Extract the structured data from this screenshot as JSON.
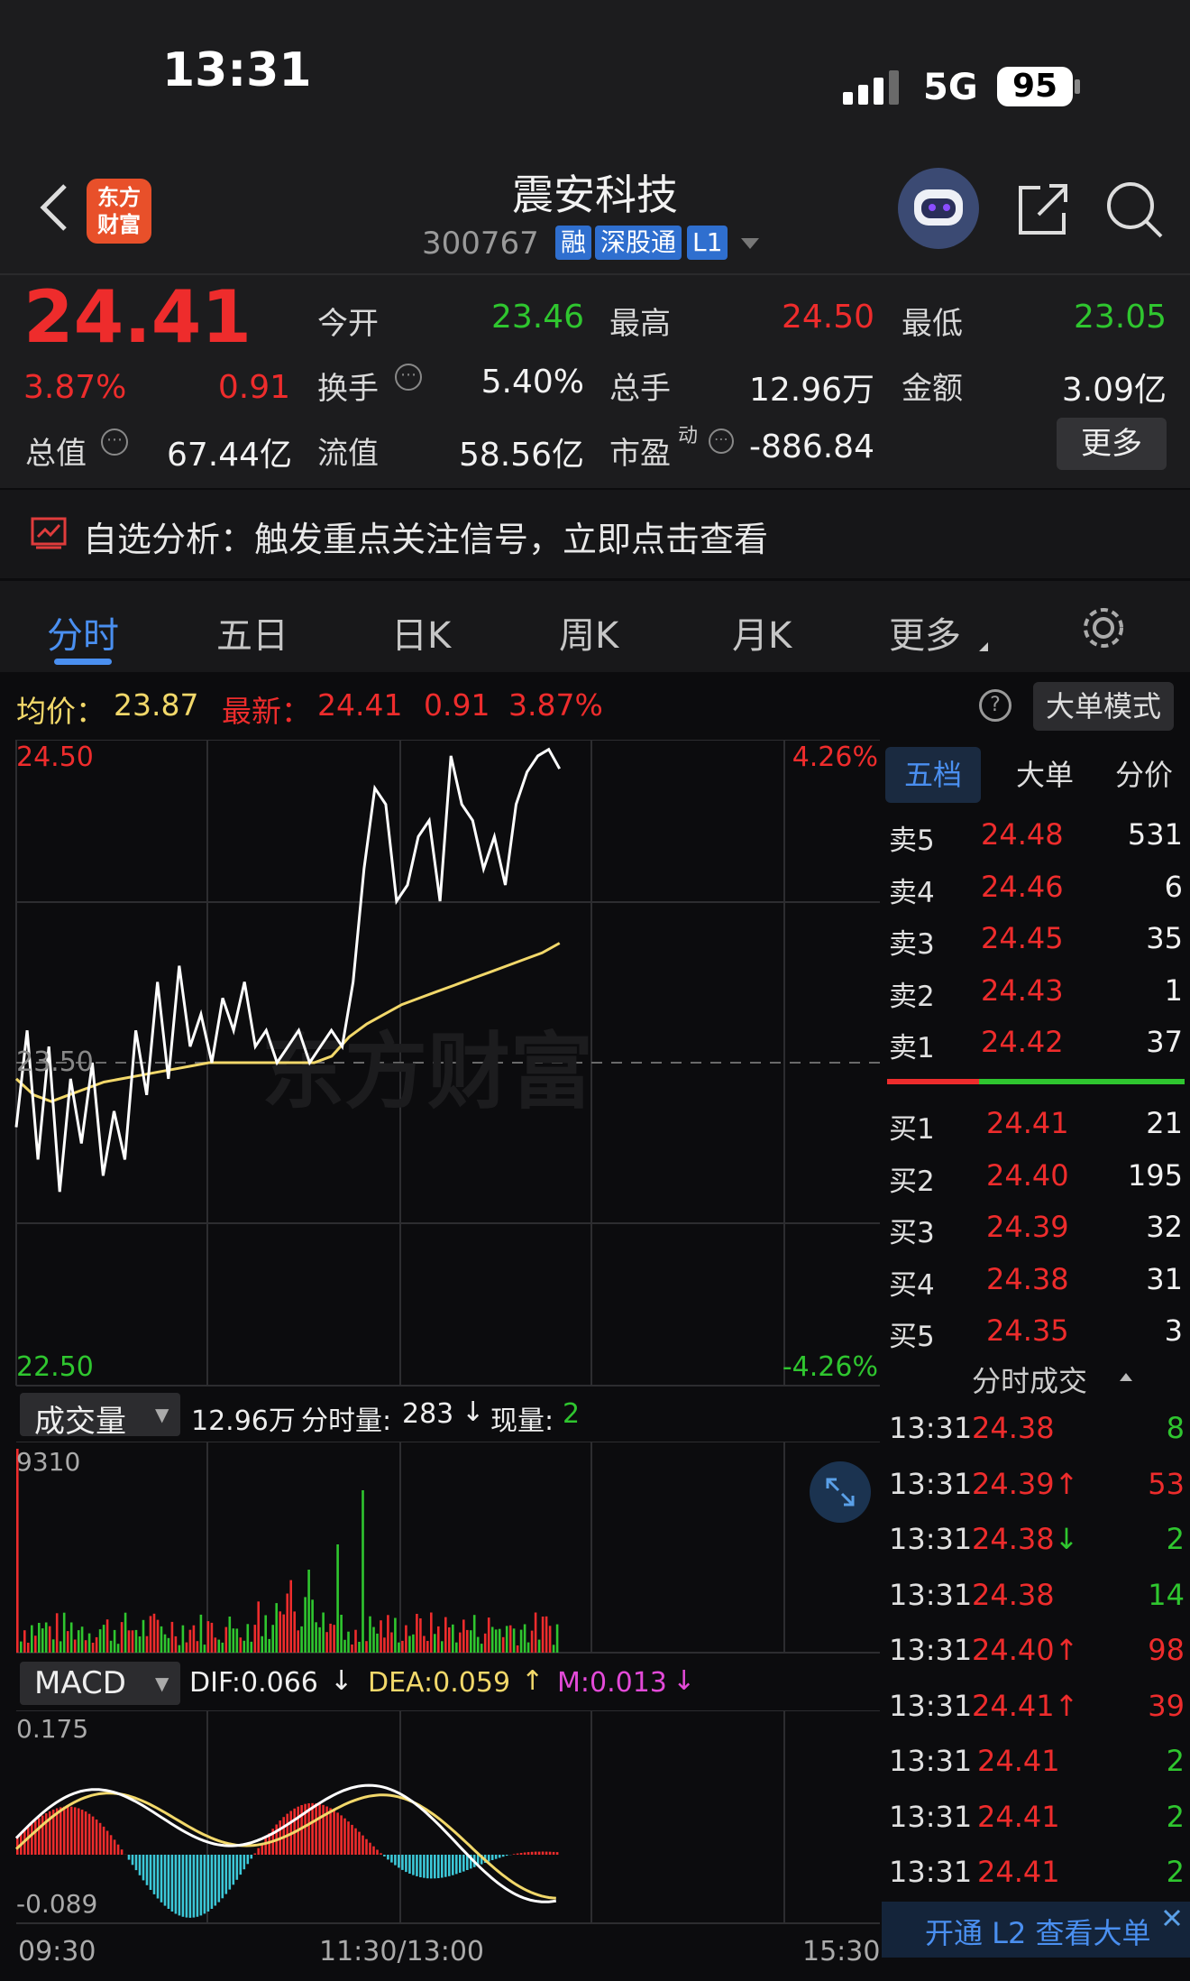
{
  "status_bar": {
    "time": "13:31",
    "network": "5G",
    "battery": "95"
  },
  "header": {
    "brand_line1": "东方",
    "brand_line2": "财富",
    "stock_name": "震安科技",
    "stock_code": "300767",
    "tags": [
      "融",
      "深股通",
      "L1"
    ]
  },
  "quote": {
    "price": "24.41",
    "change_pct": "3.87%",
    "change": "0.91",
    "fields": {
      "open_label": "今开",
      "open": "23.46",
      "high_label": "最高",
      "high": "24.50",
      "low_label": "最低",
      "low": "23.05",
      "turnover_label": "换手",
      "turnover": "5.40%",
      "volume_label": "总手",
      "volume": "12.96万",
      "amount_label": "金额",
      "amount": "3.09亿",
      "mcap_label": "总值",
      "mcap": "67.44亿",
      "float_label": "流值",
      "float": "58.56亿",
      "pe_label": "市盈",
      "pe_sup": "动",
      "pe": "-886.84"
    },
    "more_button": "更多"
  },
  "analysis_banner": "自选分析：触发重点关注信号，立即点击查看",
  "chart_tabs": [
    "分时",
    "五日",
    "日K",
    "周K",
    "月K",
    "更多"
  ],
  "active_tab": "分时",
  "summary": {
    "avg_label": "均价：",
    "avg": "23.87",
    "last_label": "最新：",
    "last": "24.41",
    "chg": "0.91",
    "pct": "3.87%",
    "mode_button": "大单模式",
    "help_icon": "?"
  },
  "chart_data": {
    "type": "line",
    "y_top": "24.50",
    "y_mid": "23.50",
    "y_bottom": "22.50",
    "pct_top": "4.26%",
    "pct_bottom": "-4.26%",
    "watermark": "东方财富",
    "x_labels": [
      "09:30",
      "11:30/13:00",
      "15:30"
    ],
    "ylim": [
      22.5,
      24.5
    ],
    "price_series": [
      23.3,
      23.6,
      23.2,
      23.55,
      23.1,
      23.45,
      23.25,
      23.5,
      23.15,
      23.35,
      23.2,
      23.6,
      23.4,
      23.75,
      23.45,
      23.8,
      23.55,
      23.65,
      23.5,
      23.7,
      23.6,
      23.75,
      23.55,
      23.6,
      23.5,
      23.55,
      23.6,
      23.5,
      23.55,
      23.6,
      23.55,
      23.75,
      24.1,
      24.35,
      24.3,
      24.0,
      24.05,
      24.2,
      24.25,
      24.0,
      24.45,
      24.3,
      24.25,
      24.1,
      24.2,
      24.05,
      24.3,
      24.4,
      24.45,
      24.47,
      24.41
    ],
    "avg_series": [
      23.45,
      23.4,
      23.38,
      23.4,
      23.42,
      23.44,
      23.45,
      23.46,
      23.47,
      23.48,
      23.49,
      23.5,
      23.5,
      23.5,
      23.5,
      23.5,
      23.5,
      23.5,
      23.52,
      23.58,
      23.62,
      23.65,
      23.68,
      23.7,
      23.72,
      23.74,
      23.76,
      23.78,
      23.8,
      23.82,
      23.84,
      23.87
    ],
    "volume_label": "成交量",
    "volume_total": "12.96万",
    "volume_period_label": "分时量:",
    "volume_period": "283",
    "volume_now_label": "现量:",
    "volume_now": "2",
    "volume_max": "9310",
    "macd_label": "MACD",
    "dif": "DIF:0.066",
    "dea": "DEA:0.059",
    "m": "M:0.013",
    "macd_top": "0.175",
    "macd_bottom": "-0.089"
  },
  "orderbook": {
    "tabs": [
      "五档",
      "大单",
      "分价"
    ],
    "asks": [
      {
        "label": "卖5",
        "price": "24.48",
        "qty": "531"
      },
      {
        "label": "卖4",
        "price": "24.46",
        "qty": "6"
      },
      {
        "label": "卖3",
        "price": "24.45",
        "qty": "35"
      },
      {
        "label": "卖2",
        "price": "24.43",
        "qty": "1"
      },
      {
        "label": "卖1",
        "price": "24.42",
        "qty": "37"
      }
    ],
    "bids": [
      {
        "label": "买1",
        "price": "24.41",
        "qty": "21"
      },
      {
        "label": "买2",
        "price": "24.40",
        "qty": "195"
      },
      {
        "label": "买3",
        "price": "24.39",
        "qty": "32"
      },
      {
        "label": "买4",
        "price": "24.38",
        "qty": "31"
      },
      {
        "label": "买5",
        "price": "24.35",
        "qty": "3"
      }
    ]
  },
  "trades": {
    "title": "分时成交",
    "rows": [
      {
        "time": "13:31",
        "price": "24.38",
        "arrow": "",
        "qty": "8",
        "dir": "buy"
      },
      {
        "time": "13:31",
        "price": "24.39",
        "arrow": "↑",
        "qty": "53",
        "dir": "sell"
      },
      {
        "time": "13:31",
        "price": "24.38",
        "arrow": "↓",
        "qty": "2",
        "dir": "buy"
      },
      {
        "time": "13:31",
        "price": "24.38",
        "arrow": "",
        "qty": "14",
        "dir": "buy"
      },
      {
        "time": "13:31",
        "price": "24.40",
        "arrow": "↑",
        "qty": "98",
        "dir": "sell"
      },
      {
        "time": "13:31",
        "price": "24.41",
        "arrow": "↑",
        "qty": "39",
        "dir": "sell"
      },
      {
        "time": "13:31",
        "price": "24.41",
        "arrow": "",
        "qty": "2",
        "dir": "buy"
      },
      {
        "time": "13:31",
        "price": "24.41",
        "arrow": "",
        "qty": "2",
        "dir": "buy"
      },
      {
        "time": "13:31",
        "price": "24.41",
        "arrow": "",
        "qty": "2",
        "dir": "buy"
      }
    ],
    "l2_banner": "开通 L2 查看大单"
  },
  "colors": {
    "up": "#ee2c2c",
    "down": "#2fc62f",
    "avg": "#f2d86a",
    "accent": "#3a7bd5"
  }
}
